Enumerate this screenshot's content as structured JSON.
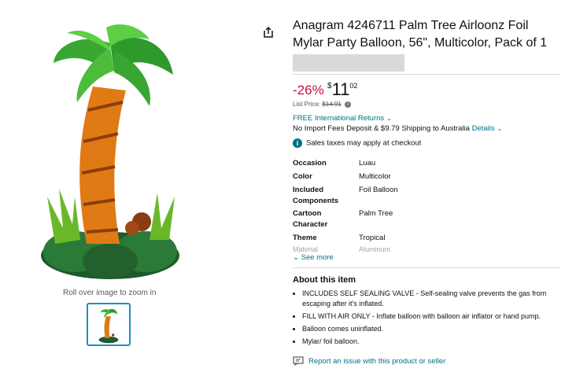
{
  "product": {
    "title": "Anagram 4246711 Palm Tree Airloonz Foil Mylar Party Balloon, 56\", Multicolor, Pack of 1"
  },
  "gallery": {
    "zoom_hint": "Roll over image to zoom in"
  },
  "pricing": {
    "discount": "-26%",
    "currency_symbol": "$",
    "price_whole": "11",
    "price_fraction": "02",
    "list_price_label": "List Price:",
    "list_price": "$14.91"
  },
  "delivery": {
    "returns_label": "FREE International Returns",
    "shipping_text": "No Import Fees Deposit & $9.79 Shipping to Australia",
    "details_link": "Details",
    "tax_note": "Sales taxes may apply at checkout"
  },
  "specs": [
    {
      "key": "Occasion",
      "value": "Luau"
    },
    {
      "key": "Color",
      "value": "Multicolor"
    },
    {
      "key": "Included Components",
      "value": "Foil Balloon"
    },
    {
      "key": "Cartoon Character",
      "value": "Palm Tree"
    },
    {
      "key": "Theme",
      "value": "Tropical"
    }
  ],
  "specs_faded": {
    "key": "Material",
    "value": "Aluminum"
  },
  "see_more": "See more",
  "about": {
    "heading": "About this item",
    "bullets": [
      "INCLUDES SELF SEALING VALVE - Self-sealing valve prevents the gas from escaping after it's inflated.",
      "FILL WITH AIR ONLY - Inflate balloon with balloon air inflator or hand pump.",
      "Balloon comes uninflated.",
      "Mylar/ foil balloon."
    ]
  },
  "report_link": "Report an issue with this product or seller",
  "colors": {
    "link": "#007185",
    "discount": "#cc0c39",
    "thumb_border": "#1f8fbf"
  },
  "icons": [
    "share-icon",
    "info-icon",
    "chevron-down-icon",
    "report-icon"
  ]
}
